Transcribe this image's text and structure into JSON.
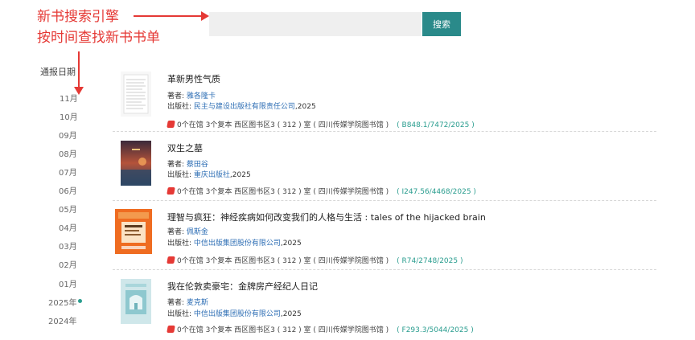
{
  "annotations": {
    "line1": "新书搜索引擎",
    "line2": "按时间查找新书书单"
  },
  "search": {
    "placeholder": "",
    "button_label": "搜索"
  },
  "timeline": {
    "title": "通报日期",
    "items": [
      "11月",
      "10月",
      "09月",
      "08月",
      "07月",
      "06月",
      "05月",
      "04月",
      "03月",
      "02月",
      "01月",
      "2025年",
      "2024年"
    ],
    "active_year": "2025年"
  },
  "labels": {
    "author": "著者: ",
    "publisher": "出版社: "
  },
  "books": [
    {
      "title": "革新男性气质",
      "author": "雅各隆卡",
      "publisher": "民主与建设出版社有限责任公司",
      "year": ",2025",
      "status": "0个在馆  3个复本  西区图书区3 ( 312 ) 室 ( 四川传媒学院图书馆 )",
      "call_number": "( B848.1/7472/2025 )"
    },
    {
      "title": "双生之墓",
      "author": "蔡田谷",
      "publisher": "重庆出版社",
      "year": ",2025",
      "status": "0个在馆  3个复本  西区图书区3 ( 312 ) 室 ( 四川传媒学院图书馆 )",
      "call_number": "( I247.56/4468/2025 )"
    },
    {
      "title": "理智与疯狂：神经疾病如何改变我们的人格与生活 : tales of the hijacked brain",
      "author": "佩斯金",
      "publisher": "中信出版集团股份有限公司",
      "year": ",2025",
      "status": "0个在馆  3个复本  西区图书区3 ( 312 ) 室 ( 四川传媒学院图书馆 )",
      "call_number": "( R74/2748/2025 )"
    },
    {
      "title": "我在伦敦卖豪宅：金牌房产经纪人日记",
      "author": "麦克斯",
      "publisher": "中信出版集团股份有限公司",
      "year": ",2025",
      "status": "0个在馆  3个复本  西区图书区3 ( 312 ) 室 ( 四川传媒学院图书馆 )",
      "call_number": "( F293.3/5044/2025 )"
    }
  ],
  "colors": {
    "accent": "#2a8a8a",
    "annotation": "#e53935",
    "link": "#2f6fb5",
    "call_number": "#2a9d8f"
  }
}
